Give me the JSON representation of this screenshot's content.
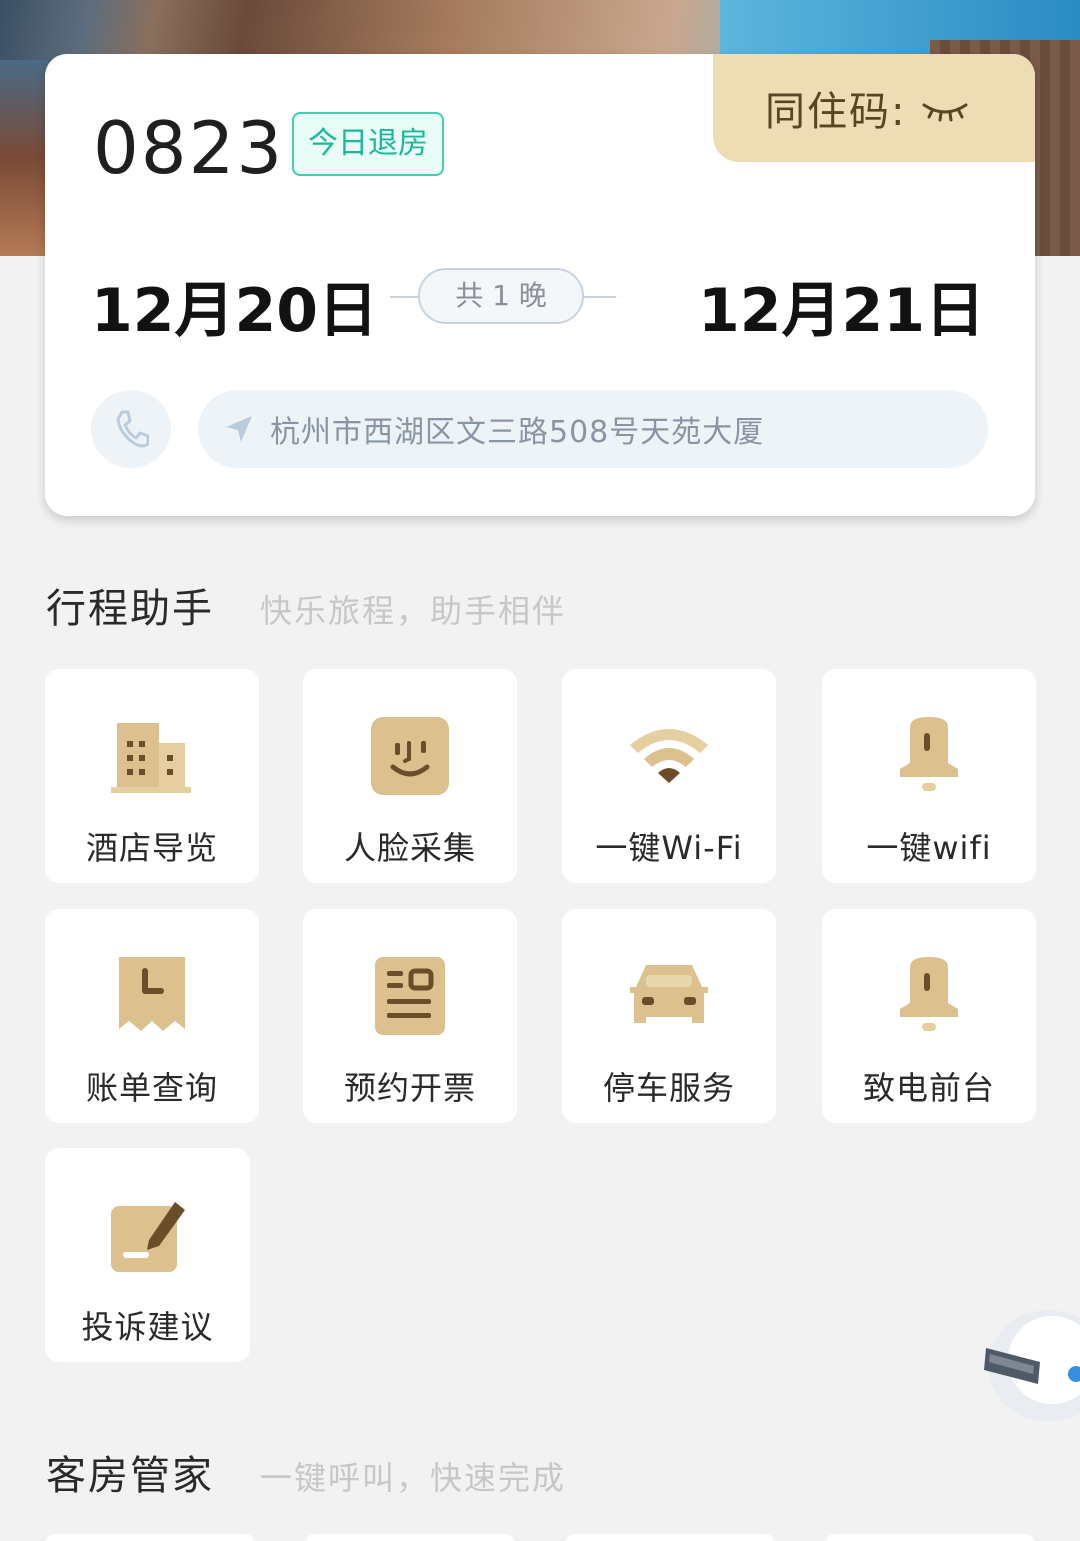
{
  "booking": {
    "room_number": "0823",
    "status_badge": "今日退房",
    "share_code_label": "同住码:",
    "checkin_date": "12月20日",
    "checkout_date": "12月21日",
    "nights_label": "共 1 晚",
    "address": "杭州市西湖区文三路508号天苑大厦"
  },
  "itinerary": {
    "title": "行程助手",
    "subtitle": "快乐旅程，助手相伴",
    "tiles": [
      {
        "label": "酒店导览",
        "icon": "building-icon"
      },
      {
        "label": "人脸采集",
        "icon": "face-icon"
      },
      {
        "label": "一键Wi-Fi",
        "icon": "wifi-icon"
      },
      {
        "label": "一键wifi",
        "icon": "bell-icon"
      },
      {
        "label": "账单查询",
        "icon": "receipt-icon"
      },
      {
        "label": "预约开票",
        "icon": "invoice-icon"
      },
      {
        "label": "停车服务",
        "icon": "car-icon"
      },
      {
        "label": "致电前台",
        "icon": "bell-icon"
      },
      {
        "label": "投诉建议",
        "icon": "edit-icon"
      }
    ]
  },
  "housekeeping": {
    "title": "客房管家",
    "subtitle": "一键呼叫，快速完成"
  },
  "colors": {
    "icon_gold": "#dcc08e",
    "icon_dark": "#6a4e2a",
    "badge_green": "#1ab99a",
    "share_tab": "#eddcb4"
  }
}
